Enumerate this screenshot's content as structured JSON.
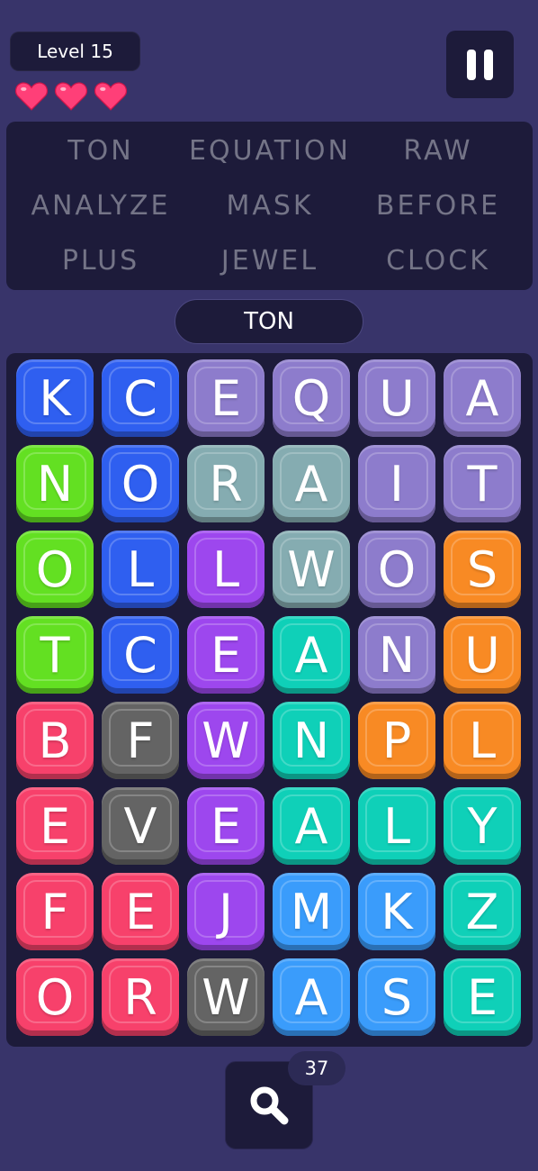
{
  "level_label": "Level 15",
  "lives": 3,
  "words": [
    "TON",
    "EQUATION",
    "RAW",
    "ANALYZE",
    "MASK",
    "BEFORE",
    "PLUS",
    "JEWEL",
    "CLOCK"
  ],
  "current_word": "TON",
  "grid": [
    [
      {
        "l": "K",
        "c": "blue"
      },
      {
        "l": "C",
        "c": "blue"
      },
      {
        "l": "E",
        "c": "lavender"
      },
      {
        "l": "Q",
        "c": "lavender"
      },
      {
        "l": "U",
        "c": "lavender"
      },
      {
        "l": "A",
        "c": "lavender"
      }
    ],
    [
      {
        "l": "N",
        "c": "green"
      },
      {
        "l": "O",
        "c": "blue"
      },
      {
        "l": "R",
        "c": "grayteal"
      },
      {
        "l": "A",
        "c": "grayteal"
      },
      {
        "l": "I",
        "c": "lavender"
      },
      {
        "l": "T",
        "c": "lavender"
      }
    ],
    [
      {
        "l": "O",
        "c": "green"
      },
      {
        "l": "L",
        "c": "blue"
      },
      {
        "l": "L",
        "c": "purple"
      },
      {
        "l": "W",
        "c": "grayteal"
      },
      {
        "l": "O",
        "c": "lavender"
      },
      {
        "l": "S",
        "c": "orange"
      }
    ],
    [
      {
        "l": "T",
        "c": "green"
      },
      {
        "l": "C",
        "c": "blue"
      },
      {
        "l": "E",
        "c": "purple"
      },
      {
        "l": "A",
        "c": "teal"
      },
      {
        "l": "N",
        "c": "lavender"
      },
      {
        "l": "U",
        "c": "orange"
      }
    ],
    [
      {
        "l": "B",
        "c": "red"
      },
      {
        "l": "F",
        "c": "gray"
      },
      {
        "l": "W",
        "c": "purple"
      },
      {
        "l": "N",
        "c": "teal"
      },
      {
        "l": "P",
        "c": "orange"
      },
      {
        "l": "L",
        "c": "orange"
      }
    ],
    [
      {
        "l": "E",
        "c": "red"
      },
      {
        "l": "V",
        "c": "gray"
      },
      {
        "l": "E",
        "c": "purple"
      },
      {
        "l": "A",
        "c": "teal"
      },
      {
        "l": "L",
        "c": "teal"
      },
      {
        "l": "Y",
        "c": "teal"
      }
    ],
    [
      {
        "l": "F",
        "c": "red"
      },
      {
        "l": "E",
        "c": "red"
      },
      {
        "l": "J",
        "c": "purple"
      },
      {
        "l": "M",
        "c": "skyblue"
      },
      {
        "l": "K",
        "c": "skyblue"
      },
      {
        "l": "Z",
        "c": "teal"
      }
    ],
    [
      {
        "l": "O",
        "c": "red"
      },
      {
        "l": "R",
        "c": "red"
      },
      {
        "l": "W",
        "c": "gray"
      },
      {
        "l": "A",
        "c": "skyblue"
      },
      {
        "l": "S",
        "c": "skyblue"
      },
      {
        "l": "E",
        "c": "teal"
      }
    ]
  ],
  "colors": {
    "blue": "#2f5ff0",
    "lavender": "#8d7ccc",
    "green": "#63e022",
    "grayteal": "#85acb1",
    "purple": "#9d47ee",
    "orange": "#f88a24",
    "teal": "#0fd0b8",
    "red": "#f7416b",
    "gray": "#646464",
    "skyblue": "#3a9cfb",
    "heart": "#ff3f78"
  },
  "hint_icon": "search-icon",
  "hint_count": "37"
}
